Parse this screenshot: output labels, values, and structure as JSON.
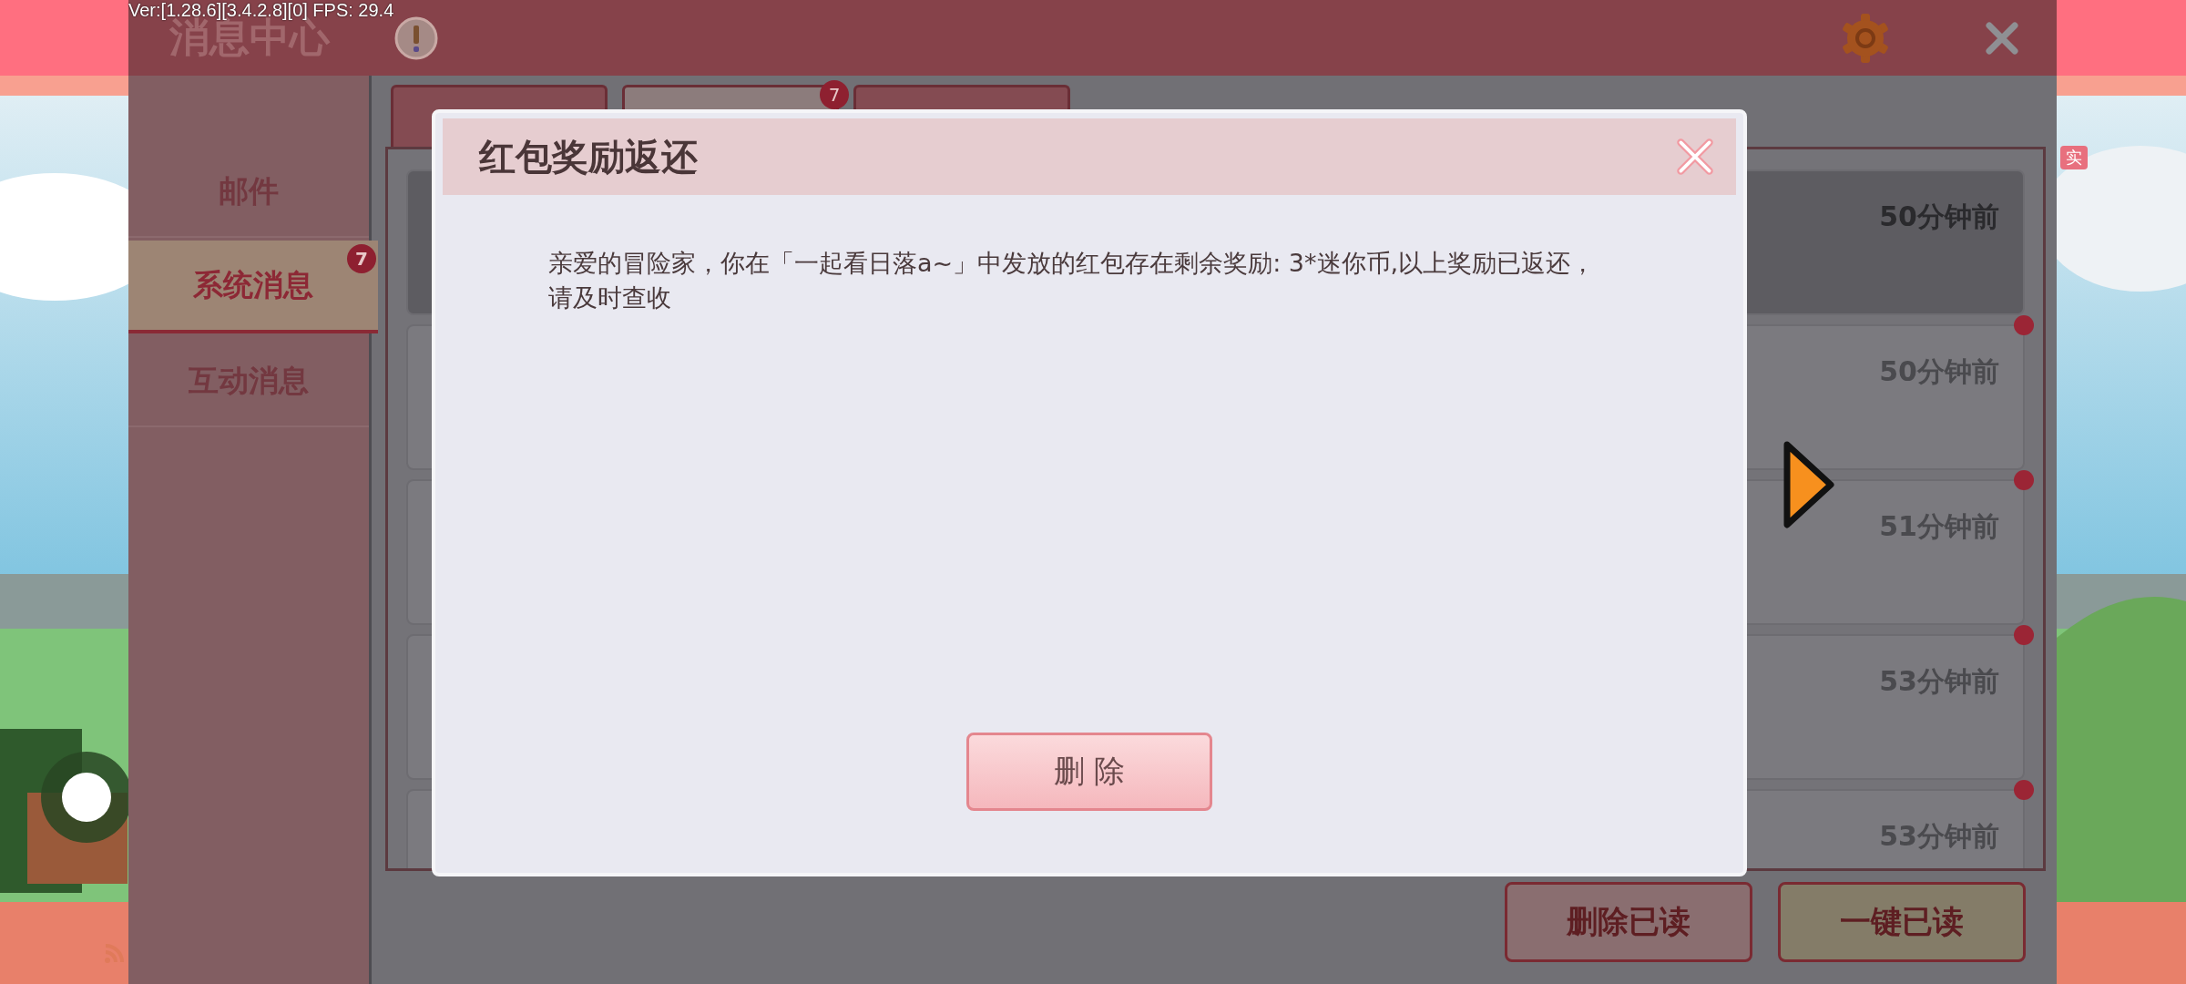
{
  "hud": {
    "version": "Ver:[1.28.6][3.4.2.8][0] FPS: 29.4",
    "side_label": "实"
  },
  "header": {
    "title": "消息中心"
  },
  "sidebar": {
    "items": [
      {
        "label": "邮件",
        "selected": false
      },
      {
        "label": "系统消息",
        "selected": true,
        "badge": "7"
      },
      {
        "label": "互动消息",
        "selected": false
      }
    ]
  },
  "tabs": [
    {
      "selected": false
    },
    {
      "selected": true,
      "badge": "7"
    },
    {
      "selected": false
    }
  ],
  "messages": [
    {
      "time": "50分钟前",
      "selected": true,
      "unread": false
    },
    {
      "time": "50分钟前",
      "selected": false,
      "unread": true
    },
    {
      "time": "51分钟前",
      "selected": false,
      "unread": true
    },
    {
      "time": "53分钟前",
      "selected": false,
      "unread": true
    },
    {
      "time": "53分钟前",
      "selected": false,
      "unread": true
    }
  ],
  "actions": [
    "删除已读",
    "一键已读"
  ],
  "dialog": {
    "title": "红包奖励返还",
    "body": "亲爱的冒险家，你在「一起看日落a~」中发放的红包存在剩余奖励: 3*迷你币,以上奖励已返还，请及时查收",
    "button": "删 除"
  }
}
